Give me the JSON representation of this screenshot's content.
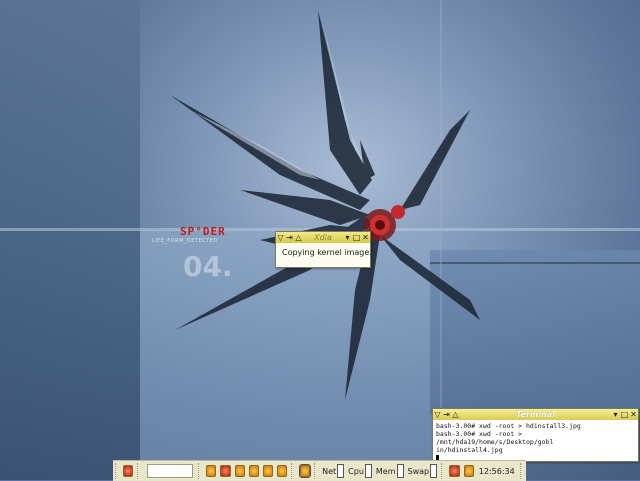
{
  "wallpaper": {
    "logo": "SP°DER",
    "sub": "LIFE_FORM_DETECTED",
    "number": "04."
  },
  "dialog": {
    "title": "Xdia",
    "message": "Copying kernel image..."
  },
  "terminal": {
    "title": "Terminal",
    "lines": [
      "bash-3.00# xwd -root > hdinstall3.jpg",
      "bash-3.00# xwd -root > /mnt/hda19/home/s/Desktop/gobl",
      "in/hdinstall4.jpg"
    ]
  },
  "taskbar": {
    "net": "Net",
    "cpu": "Cpu",
    "mem": "Mem",
    "swap": "Swap",
    "clock": "12:56:34"
  },
  "colors": {
    "titlebar": "#d6c84a",
    "taskbar": "#e9e6c9",
    "accent_red": "#c11c1c"
  }
}
